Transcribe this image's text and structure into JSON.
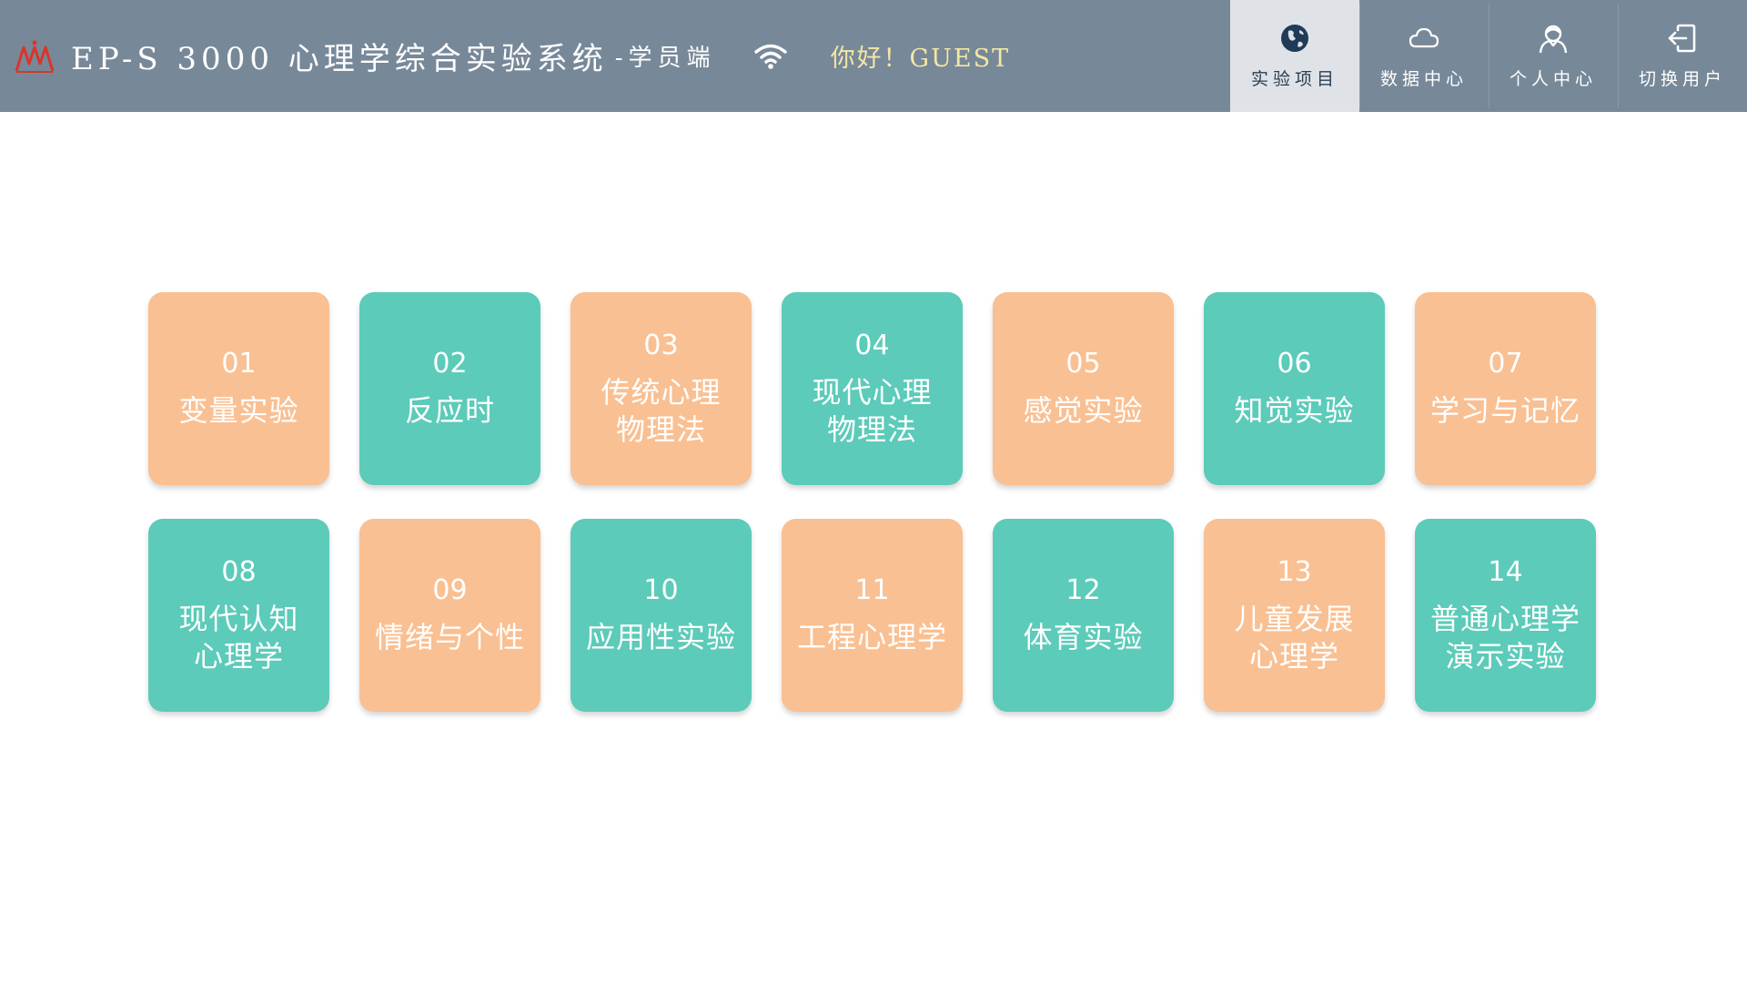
{
  "header": {
    "title": "EP-S 3000  心理学综合实验系统",
    "subtitle": "-学员端",
    "greeting": "你好！GUEST",
    "colors": {
      "bar": "#778899",
      "greeting": "#f4e7a3",
      "logo": "#d9352b"
    },
    "icons": {
      "logo": "brand-logo-icon",
      "wifi": "wifi-icon"
    }
  },
  "nav": {
    "items": [
      {
        "label": "实验项目",
        "icon": "globe-icon",
        "active": true
      },
      {
        "label": "数据中心",
        "icon": "cloud-icon",
        "active": false
      },
      {
        "label": "个人中心",
        "icon": "user-icon",
        "active": false
      },
      {
        "label": "切换用户",
        "icon": "logout-icon",
        "active": false
      }
    ]
  },
  "tiles": [
    {
      "num": "01",
      "label": "变量实验",
      "color": "orange"
    },
    {
      "num": "02",
      "label": "反应时",
      "color": "teal"
    },
    {
      "num": "03",
      "label": "传统心理\n物理法",
      "color": "orange"
    },
    {
      "num": "04",
      "label": "现代心理\n物理法",
      "color": "teal"
    },
    {
      "num": "05",
      "label": "感觉实验",
      "color": "orange"
    },
    {
      "num": "06",
      "label": "知觉实验",
      "color": "teal"
    },
    {
      "num": "07",
      "label": "学习与记忆",
      "color": "orange"
    },
    {
      "num": "08",
      "label": "现代认知\n心理学",
      "color": "teal"
    },
    {
      "num": "09",
      "label": "情绪与个性",
      "color": "orange"
    },
    {
      "num": "10",
      "label": "应用性实验",
      "color": "teal"
    },
    {
      "num": "11",
      "label": "工程心理学",
      "color": "orange"
    },
    {
      "num": "12",
      "label": "体育实验",
      "color": "teal"
    },
    {
      "num": "13",
      "label": "儿童发展\n心理学",
      "color": "orange"
    },
    {
      "num": "14",
      "label": "普通心理学\n演示实验",
      "color": "teal"
    }
  ],
  "tile_colors": {
    "orange": "#f9c093",
    "teal": "#5ccbb9"
  }
}
